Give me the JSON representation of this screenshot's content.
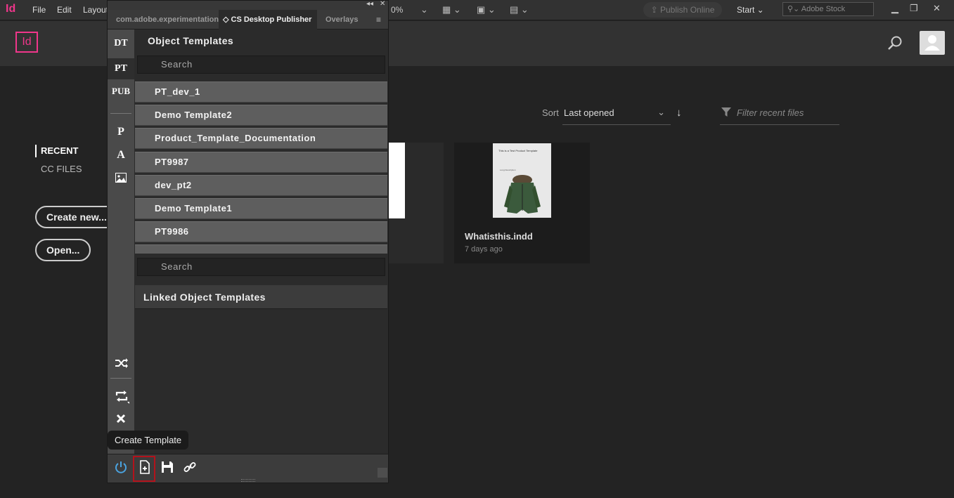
{
  "menubar": {
    "app": "Id",
    "items": [
      "File",
      "Edit",
      "Layout"
    ],
    "zoom": "0%",
    "publish_online": "Publish Online",
    "workspace": "Start",
    "stock_search_placeholder": "Adobe Stock"
  },
  "home": {
    "logo": "Id",
    "nav": {
      "recent": "RECENT",
      "cc_files": "CC FILES"
    },
    "create_new": "Create new...",
    "open": "Open...",
    "sort_label": "Sort",
    "sort_value": "Last opened",
    "filter_placeholder": "Filter recent files",
    "files": [
      {
        "name": "Whatisthis.indd",
        "date": "7 days ago",
        "thumb_title": "This is a Test Product Template",
        "thumb_sub": "Long Description"
      }
    ]
  },
  "panel": {
    "tabs": [
      "com.adobe.experimentation",
      "CS Desktop Publisher",
      "Overlays"
    ],
    "active_tab": "CS Desktop Publisher",
    "tools": [
      "DT",
      "PT",
      "PUB",
      "P",
      "A"
    ],
    "active_tool": "PT",
    "section_title": "Object Templates",
    "search_placeholder": "Search",
    "templates": [
      "PT_dev_1",
      "Demo Template2",
      "Product_Template_Documentation",
      "PT9987",
      "dev_pt2",
      "Demo Template1",
      "PT9986"
    ],
    "linked_search_placeholder": "Search",
    "linked_title": "Linked Object Templates",
    "tooltip": "Create Template"
  },
  "colors": {
    "accent": "#f0368b",
    "highlight": "#b3121b",
    "power": "#4aa3e0"
  }
}
